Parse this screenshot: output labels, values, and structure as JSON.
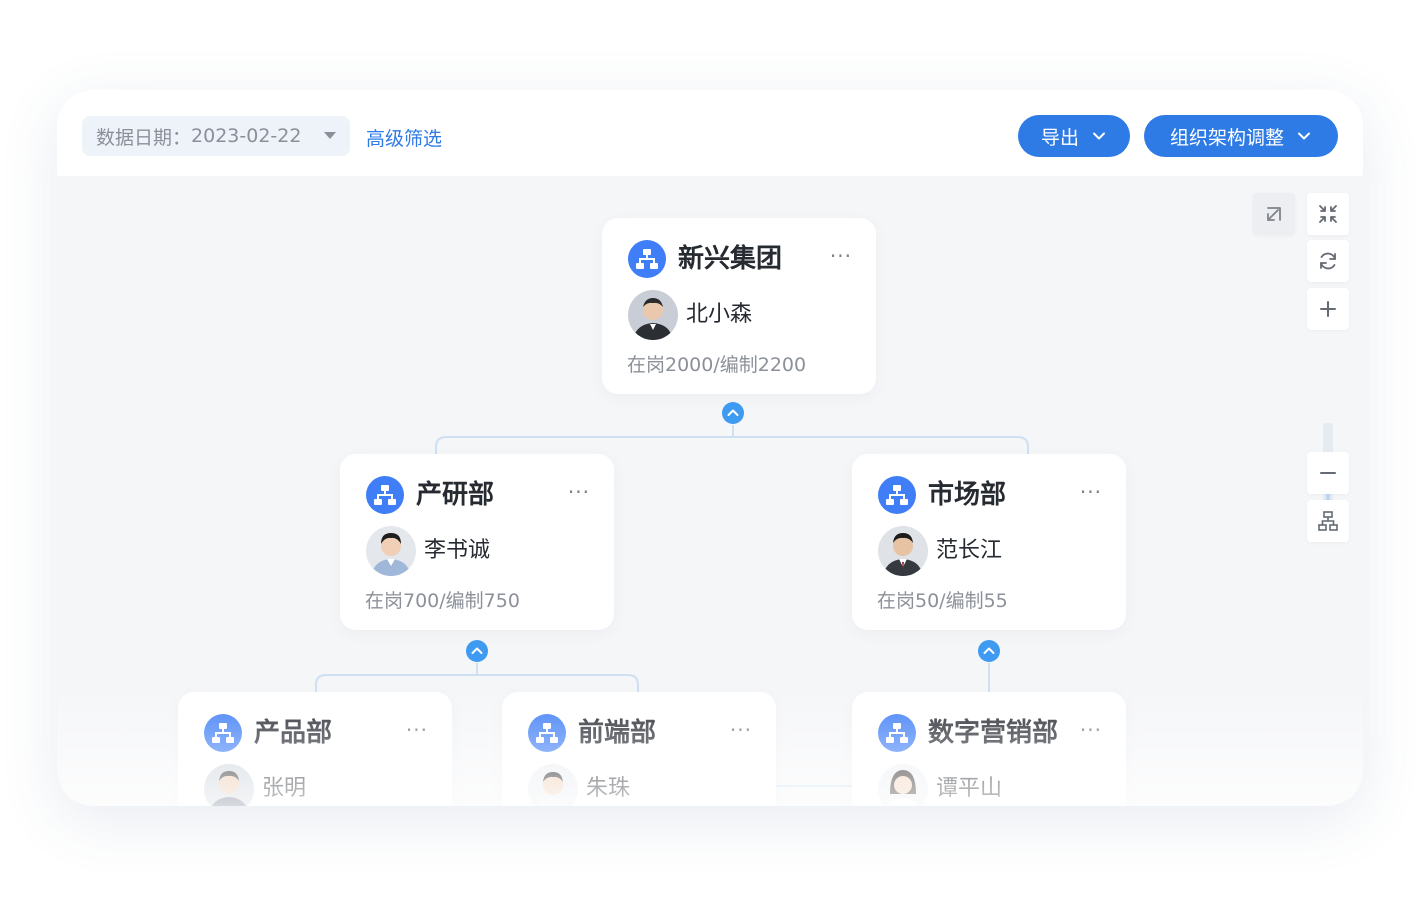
{
  "toolbar": {
    "date_label": "数据日期：",
    "date_value": "2023-02-22",
    "advanced_filter": "高级筛选",
    "export_label": "导出",
    "adjust_label": "组织架构调整"
  },
  "colors": {
    "primary": "#2f7be5",
    "org_icon": "#3f7ef6",
    "toggle": "#3f9bf1",
    "canvas_bg": "#f5f6f8"
  },
  "tools": [
    "restore-icon",
    "collapse-icon",
    "refresh-icon",
    "zoom-in-icon",
    "zoom-out-icon",
    "org-layout-icon"
  ],
  "zoom_level": 0.5,
  "nodes": {
    "root": {
      "name": "新兴集团",
      "more": "···",
      "leader": "北小森",
      "stats": "在岗2000/编制2200"
    },
    "rnd": {
      "name": "产研部",
      "more": "···",
      "leader": "李书诚",
      "stats": "在岗700/编制750"
    },
    "market": {
      "name": "市场部",
      "more": "···",
      "leader": "范长江",
      "stats": "在岗50/编制55"
    },
    "product": {
      "name": "产品部",
      "more": "···",
      "leader": "张明"
    },
    "frontend": {
      "name": "前端部",
      "more": "···",
      "leader": "朱珠"
    },
    "digital": {
      "name": "数字营销部",
      "more": "···",
      "leader": "谭平山"
    }
  }
}
